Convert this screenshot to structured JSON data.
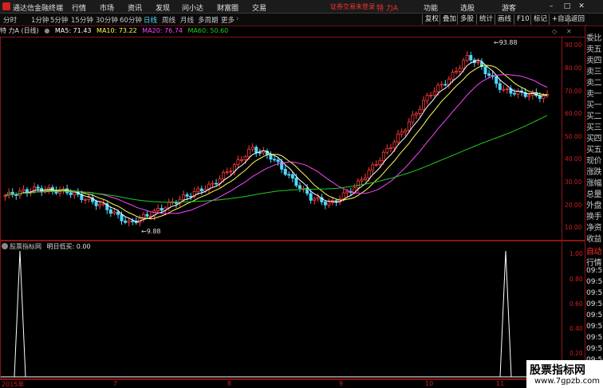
{
  "app": {
    "title": "通达信金融终端"
  },
  "menu": {
    "items": [
      "行情",
      "市场",
      "资讯",
      "发现",
      "问小达",
      "财富圈",
      "交易"
    ],
    "login_notice": "证券交易未登录",
    "stock_name": "特 力A",
    "right_items": [
      "功能",
      "选股",
      "游客"
    ]
  },
  "periods": {
    "items": [
      "分时",
      "1分钟",
      "5分钟",
      "15分钟",
      "30分钟",
      "60分钟",
      "日线",
      "周线",
      "月线",
      "多周期",
      "更多"
    ],
    "active": "日线"
  },
  "toolbar_right": [
    "复权",
    "叠加",
    "多股",
    "统计",
    "画线",
    "F10",
    "标记",
    "+自选",
    "返回"
  ],
  "indicator": {
    "label": "特 力A (日线)",
    "ma5": "MA5: 71.43",
    "ma10": "MA10: 73.22",
    "ma20": "MA20: 76.74",
    "ma60": "MA60: 50.60",
    "colors": {
      "ma5": "#ffffff",
      "ma10": "#ffff55",
      "ma20": "#ff44ff",
      "ma60": "#22cc22"
    }
  },
  "price_axis": [
    "90.00",
    "80.00",
    "70.00",
    "60.00",
    "50.00",
    "40.00",
    "30.00",
    "20.00",
    "10.00"
  ],
  "annotations": {
    "high": "93.88",
    "low": "9.88"
  },
  "sub_indicator": {
    "name": "股票指标网",
    "label": "明日低买: 0.00"
  },
  "sub_axis": [
    "1.00",
    "0.80",
    "0.60",
    "0.40",
    "0.20"
  ],
  "dates": [
    "2015年",
    "7",
    "8",
    "9",
    "10",
    "11"
  ],
  "sidebar": {
    "items": [
      "委比",
      "卖五",
      "卖四",
      "卖三",
      "卖二",
      "卖一",
      "买一",
      "买二",
      "买三",
      "买四",
      "买五",
      "现价",
      "涨跌",
      "涨幅",
      "总量",
      "外盘",
      "换手",
      "净资",
      "收益"
    ],
    "tab": "自动",
    "tab2": "行情",
    "times": [
      "09:51",
      "09:51",
      "09:52",
      "09:52",
      "09:52",
      "09:52",
      "09:53",
      "09:53",
      "09:53"
    ]
  },
  "watermark": {
    "line1": "股票指标网",
    "line2": "www.7gpzb.com"
  }
}
